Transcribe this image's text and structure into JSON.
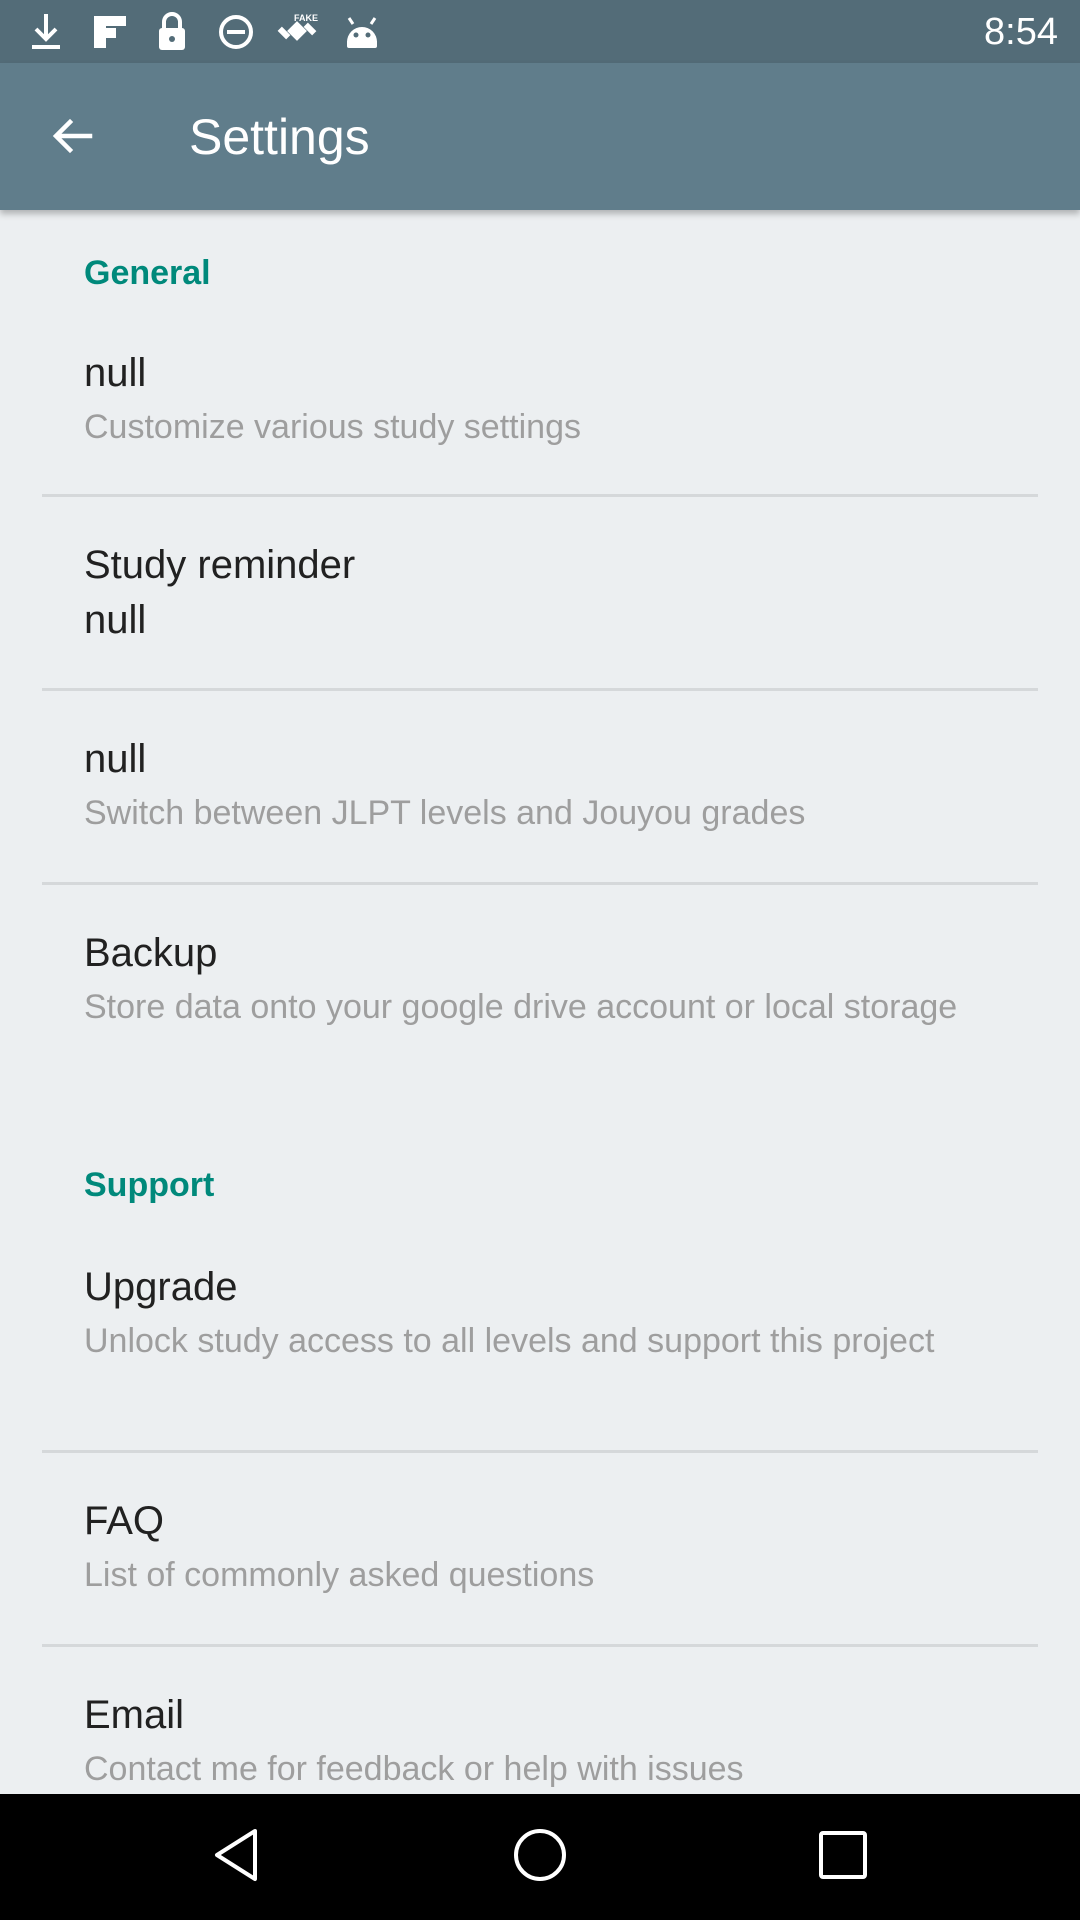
{
  "status_bar": {
    "time": "8:54",
    "icons": [
      "download-icon",
      "flipboard-icon",
      "lock-icon",
      "data-saver-icon",
      "fake-gps-icon",
      "android-icon"
    ]
  },
  "app_bar": {
    "title": "Settings",
    "back_icon": "arrow-back-icon"
  },
  "sections": {
    "general": {
      "header": "General",
      "items": [
        {
          "title": "null",
          "summary": "Customize various study settings"
        },
        {
          "title": "Study reminder",
          "summary": "null"
        },
        {
          "title": "null",
          "summary": "Switch between JLPT levels and Jouyou grades"
        },
        {
          "title": "Backup",
          "summary": "Store data onto your google drive account or local storage"
        }
      ]
    },
    "support": {
      "header": "Support",
      "items": [
        {
          "title": "Upgrade",
          "summary": "Unlock study access to all levels and support this project"
        },
        {
          "title": "FAQ",
          "summary": "List of commonly asked questions"
        },
        {
          "title": "Email",
          "summary": "Contact me for feedback or help with issues"
        }
      ]
    }
  },
  "nav_bar": {
    "icons": [
      "back-triangle-icon",
      "home-circle-icon",
      "recents-square-icon"
    ]
  },
  "colors": {
    "status_bar": "#536c78",
    "app_bar": "#607d8b",
    "accent": "#00897b",
    "background": "#eceff1"
  }
}
